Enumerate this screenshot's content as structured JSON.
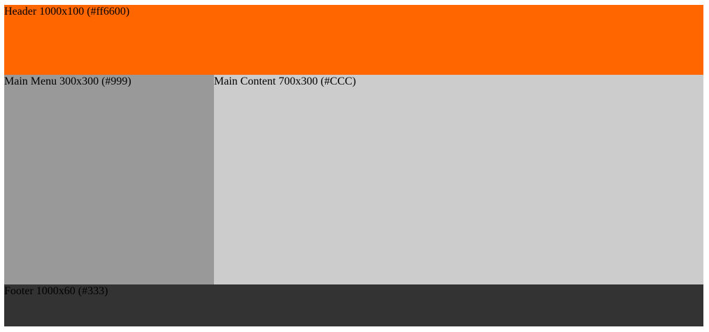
{
  "header": {
    "label": "Header 1000x100 (#ff6600)",
    "color": "#ff6600"
  },
  "main_menu": {
    "label": "Main Menu 300x300 (#999)",
    "color": "#999999"
  },
  "main_content": {
    "label": "Main Content 700x300 (#CCC)",
    "color": "#cccccc"
  },
  "footer": {
    "label": "Footer 1000x60 (#333)",
    "color": "#333333"
  }
}
